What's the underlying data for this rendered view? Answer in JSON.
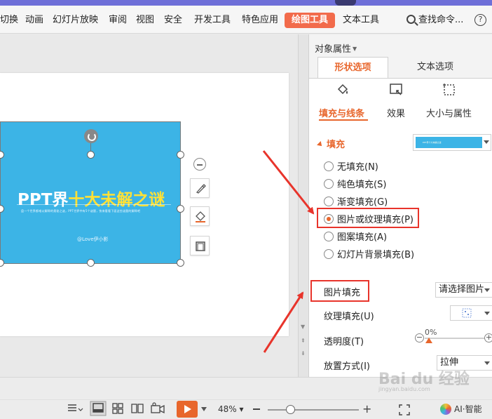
{
  "ribbon": {
    "tabs": [
      "切换",
      "动画",
      "幻灯片放映",
      "审阅",
      "视图",
      "安全",
      "开发工具",
      "特色应用",
      "绘图工具",
      "文本工具"
    ],
    "active_tab": "绘图工具",
    "search_label": "查找命令...",
    "help_label": "?"
  },
  "slide": {
    "title_white": "PPT界",
    "title_yellow": "十大未解之谜",
    "subtitle": "盘一个世界都难以解释的奥秘之谜，PPT世界中有5个谜题，快来看看下面这些谜题的解释吧",
    "author": "@Love伊小影"
  },
  "panel": {
    "title": "对象属性",
    "tabs": {
      "shape": "形状选项",
      "text": "文本选项"
    },
    "subtabs": {
      "fill_line": "填充与线条",
      "effects": "效果",
      "size_props": "大小与属性"
    },
    "fill_header": "填充",
    "fill_swatch_text": "PPT界十大未解之谜",
    "fill_options": [
      {
        "label": "无填充(N)",
        "checked": false
      },
      {
        "label": "纯色填充(S)",
        "checked": false
      },
      {
        "label": "渐变填充(G)",
        "checked": false
      },
      {
        "label": "图片或纹理填充(P)",
        "checked": true
      },
      {
        "label": "图案填充(A)",
        "checked": false
      },
      {
        "label": "幻灯片背景填充(B)",
        "checked": false
      }
    ],
    "picture_fill_label": "图片填充",
    "picture_fill_value": "请选择图片",
    "texture_fill_label": "纹理填充(U)",
    "transparency_label": "透明度(T)",
    "transparency_value": "0%",
    "placement_label": "放置方式(I)",
    "placement_value": "拉伸"
  },
  "statusbar": {
    "zoom": "48%",
    "ai_label": "AI·智能"
  },
  "watermark": {
    "text": "Bai du 经验",
    "sub": "jingyan.baidu.com"
  },
  "colors": {
    "accent": "#e8662c",
    "slide_shape": "#3cb4e6",
    "annotation_red": "#e8342b"
  }
}
